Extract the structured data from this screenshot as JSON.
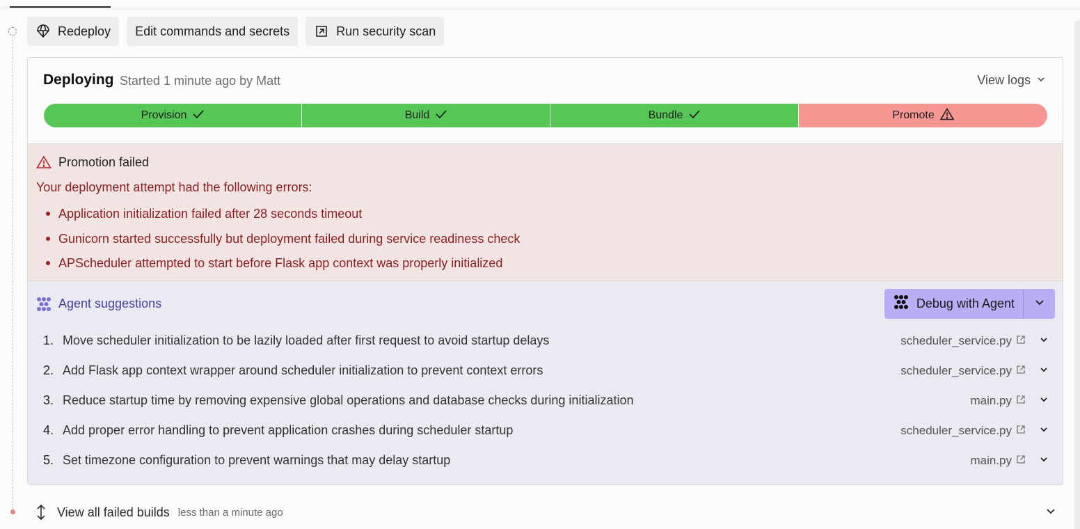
{
  "toolbar": {
    "redeploy_label": "Redeploy",
    "edit_label": "Edit commands and secrets",
    "scan_label": "Run security scan"
  },
  "deployment": {
    "status": "Deploying",
    "subtitle": "Started 1 minute ago by Matt",
    "view_logs_label": "View logs",
    "stages": [
      {
        "label": "Provision",
        "state": "success"
      },
      {
        "label": "Build",
        "state": "success"
      },
      {
        "label": "Bundle",
        "state": "success"
      },
      {
        "label": "Promote",
        "state": "failed"
      }
    ]
  },
  "error": {
    "title": "Promotion failed",
    "intro": "Your deployment attempt had the following errors:",
    "items": [
      "Application initialization failed after 28 seconds timeout",
      "Gunicorn started successfully but deployment failed during service readiness check",
      "APScheduler attempted to start before Flask app context was properly initialized"
    ]
  },
  "agent": {
    "title": "Agent suggestions",
    "debug_label": "Debug with Agent",
    "suggestions": [
      {
        "num": "1.",
        "text": "Move scheduler initialization to be lazily loaded after first request to avoid startup delays",
        "file": "scheduler_service.py"
      },
      {
        "num": "2.",
        "text": "Add Flask app context wrapper around scheduler initialization to prevent context errors",
        "file": "scheduler_service.py"
      },
      {
        "num": "3.",
        "text": "Reduce startup time by removing expensive global operations and database checks during initialization",
        "file": "main.py"
      },
      {
        "num": "4.",
        "text": "Add proper error handling to prevent application crashes during scheduler startup",
        "file": "scheduler_service.py"
      },
      {
        "num": "5.",
        "text": "Set timezone configuration to prevent warnings that may delay startup",
        "file": "main.py"
      }
    ]
  },
  "failed_builds": {
    "label": "View all failed builds",
    "time": "less than a minute ago"
  },
  "colors": {
    "stage_success": "#56c756",
    "stage_failed": "#f59693",
    "error_bg": "#f3e4e4",
    "error_text": "#8a1d1d",
    "agent_bg": "#eaeaf3",
    "agent_accent": "#4a40a0",
    "debug_button": "#b8aef5"
  },
  "icons": {
    "redeploy": "parachute-icon",
    "scan": "external-scan-icon",
    "error": "warning-triangle-icon",
    "agent": "agent-dots-icon",
    "file_link": "external-link-icon",
    "expand": "chevron-down-icon",
    "failed_builds": "vertical-arrows-icon"
  }
}
